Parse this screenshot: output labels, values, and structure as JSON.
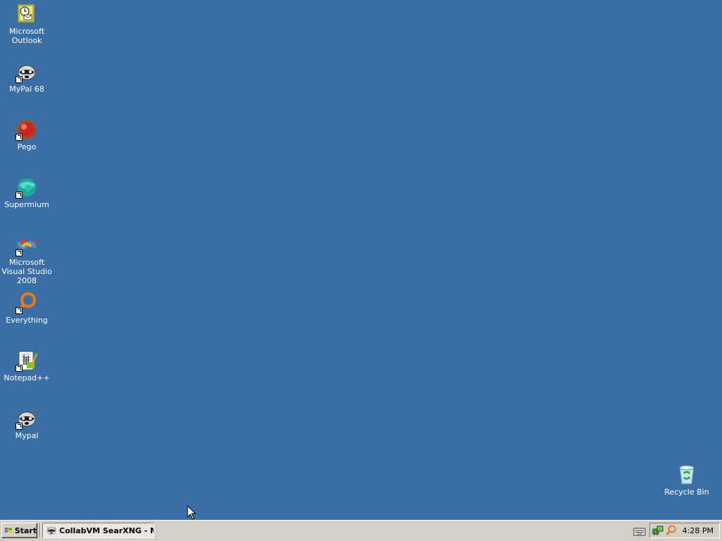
{
  "desktop": {
    "background_color": "#3a6ea5",
    "icons": [
      {
        "label": "Microsoft Outlook",
        "icon": "outlook-icon",
        "shortcut": false
      },
      {
        "label": "MyPal 68",
        "icon": "raccoon-icon",
        "shortcut": true
      },
      {
        "label": "Pego",
        "icon": "red-orb-icon",
        "shortcut": true
      },
      {
        "label": "Supermium",
        "icon": "teal-orb-icon",
        "shortcut": true
      },
      {
        "label": "Microsoft Visual Studio 2008",
        "icon": "visual-studio-icon",
        "shortcut": true
      },
      {
        "label": "Everything",
        "icon": "magnifier-icon",
        "shortcut": true
      },
      {
        "label": "Notepad++",
        "icon": "notepad-plus-plus-icon",
        "shortcut": true
      },
      {
        "label": "Mypal",
        "icon": "raccoon-icon",
        "shortcut": true
      }
    ],
    "recycle_bin": {
      "label": "Recycle Bin",
      "icon": "recycle-bin-icon"
    }
  },
  "taskbar": {
    "start_label": "Start",
    "task_button_label": "CollabVM SearXNG - M...",
    "clock": "4:28 PM",
    "tray_icons": [
      "network-icon",
      "search-icon"
    ],
    "ime_icon": "keyboard-icon",
    "background_color": "#d4d0c8"
  }
}
